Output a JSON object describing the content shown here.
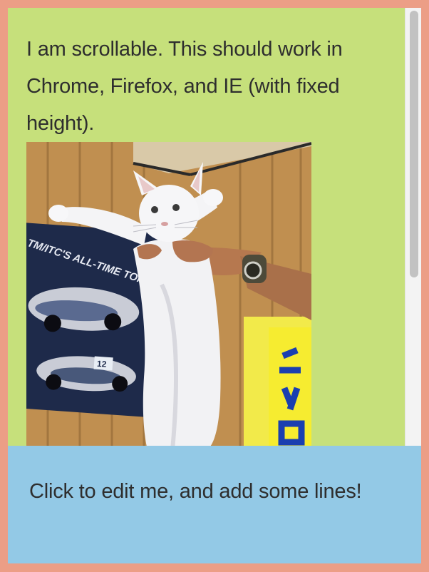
{
  "scroll_region": {
    "text": "I am scrollable. This should work in Chrome, Firefox, and IE (with fixed height).",
    "image": {
      "description_icon": "long-cat-photo",
      "poster_title": "TM/ITC'S ALL-TIME TOP TEAM.",
      "car_number": "12"
    },
    "scroll_fraction_visible": 0.6
  },
  "editable_box": {
    "text": "Click to edit me, and add some lines!"
  },
  "colors": {
    "frame": "#ec9e86",
    "scroll_bg": "#c6e07b",
    "editable_bg": "#93c9e6",
    "text": "#2e2e2e"
  }
}
